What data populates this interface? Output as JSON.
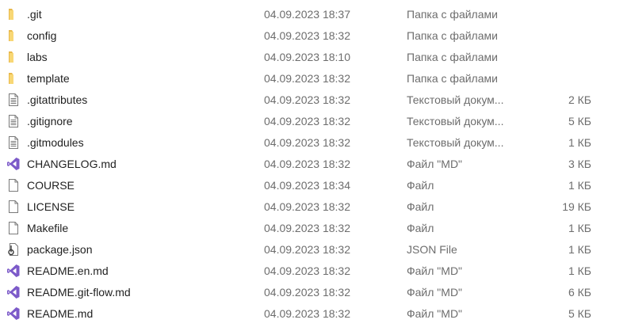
{
  "files": [
    {
      "name": ".git",
      "date": "04.09.2023 18:37",
      "type": "Папка с файлами",
      "size": "",
      "icon": "folder-icon"
    },
    {
      "name": "config",
      "date": "04.09.2023 18:32",
      "type": "Папка с файлами",
      "size": "",
      "icon": "folder-icon"
    },
    {
      "name": "labs",
      "date": "04.09.2023 18:10",
      "type": "Папка с файлами",
      "size": "",
      "icon": "folder-icon"
    },
    {
      "name": "template",
      "date": "04.09.2023 18:32",
      "type": "Папка с файлами",
      "size": "",
      "icon": "folder-icon"
    },
    {
      "name": ".gitattributes",
      "date": "04.09.2023 18:32",
      "type": "Текстовый докум...",
      "size": "2 КБ",
      "icon": "text-file-icon"
    },
    {
      "name": ".gitignore",
      "date": "04.09.2023 18:32",
      "type": "Текстовый докум...",
      "size": "5 КБ",
      "icon": "text-file-icon"
    },
    {
      "name": ".gitmodules",
      "date": "04.09.2023 18:32",
      "type": "Текстовый докум...",
      "size": "1 КБ",
      "icon": "text-file-icon"
    },
    {
      "name": "CHANGELOG.md",
      "date": "04.09.2023 18:32",
      "type": "Файл \"MD\"",
      "size": "3 КБ",
      "icon": "visual-studio-file-icon"
    },
    {
      "name": "COURSE",
      "date": "04.09.2023 18:34",
      "type": "Файл",
      "size": "1 КБ",
      "icon": "blank-file-icon"
    },
    {
      "name": "LICENSE",
      "date": "04.09.2023 18:32",
      "type": "Файл",
      "size": "19 КБ",
      "icon": "blank-file-icon"
    },
    {
      "name": "Makefile",
      "date": "04.09.2023 18:32",
      "type": "Файл",
      "size": "1 КБ",
      "icon": "blank-file-icon"
    },
    {
      "name": "package.json",
      "date": "04.09.2023 18:32",
      "type": "JSON File",
      "size": "1 КБ",
      "icon": "json-file-icon"
    },
    {
      "name": "README.en.md",
      "date": "04.09.2023 18:32",
      "type": "Файл \"MD\"",
      "size": "1 КБ",
      "icon": "visual-studio-file-icon"
    },
    {
      "name": "README.git-flow.md",
      "date": "04.09.2023 18:32",
      "type": "Файл \"MD\"",
      "size": "6 КБ",
      "icon": "visual-studio-file-icon"
    },
    {
      "name": "README.md",
      "date": "04.09.2023 18:32",
      "type": "Файл \"MD\"",
      "size": "5 КБ",
      "icon": "visual-studio-file-icon"
    }
  ],
  "colors": {
    "folder": "#f8d775",
    "folder_dark": "#e8b84a",
    "vs_purple": "#7c5ac9",
    "text_secondary": "#6d6d6d"
  }
}
